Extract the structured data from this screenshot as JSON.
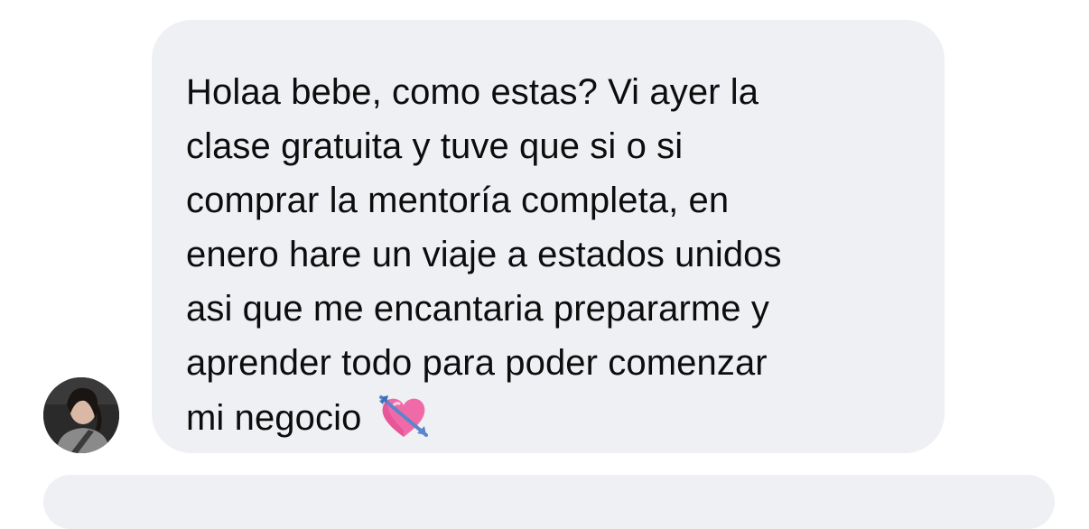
{
  "conversation": {
    "incoming_message": {
      "lines": [
        "Holaa bebe, como estas? Vi ayer la",
        "clase gratuita y tuve que si o si",
        "comprar la mentoría completa, en",
        "enero hare un viaje a estados unidos",
        "asi que me encantaria prepararme y",
        "aprender todo para poder comenzar",
        "mi negocio"
      ],
      "emoji": "heart-with-arrow-icon",
      "bubble_color": "#eff0f4",
      "text_color": "#0d0d0d"
    },
    "sender_avatar": "avatar",
    "next_message_bubble": {
      "bubble_color": "#eff0f4"
    }
  }
}
